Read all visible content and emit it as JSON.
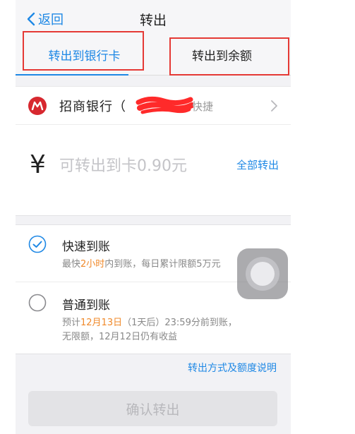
{
  "nav": {
    "back_label": "返回",
    "title": "转出"
  },
  "tabs": [
    {
      "label": "转出到银行卡",
      "active": true
    },
    {
      "label": "转出到余额",
      "active": false
    }
  ],
  "bank": {
    "name": "招商银行（",
    "tag": "快捷",
    "logo_color": "#d7282f",
    "logo": "cmb-bank-logo"
  },
  "amount": {
    "currency_symbol": "¥",
    "placeholder": "可转出到卡0.90元",
    "value": "",
    "all_label": "全部转出"
  },
  "options": [
    {
      "title": "快速到账",
      "selected": true,
      "sub_prefix": "最快",
      "sub_highlight": "2小时",
      "sub_suffix": "内到账，每日累计限额5万元"
    },
    {
      "title": "普通到账",
      "selected": false,
      "sub_prefix": "预计",
      "sub_highlight": "12月13日",
      "sub_suffix": "（1天后）23:59分前到账，",
      "sub_line2": "无限额，12月12日仍有收益"
    }
  ],
  "help_link": "转出方式及额度说明",
  "confirm_label": "确认转出",
  "colors": {
    "accent": "#1e88e5",
    "highlight": "#f0892a",
    "annotation": "#e53935"
  }
}
